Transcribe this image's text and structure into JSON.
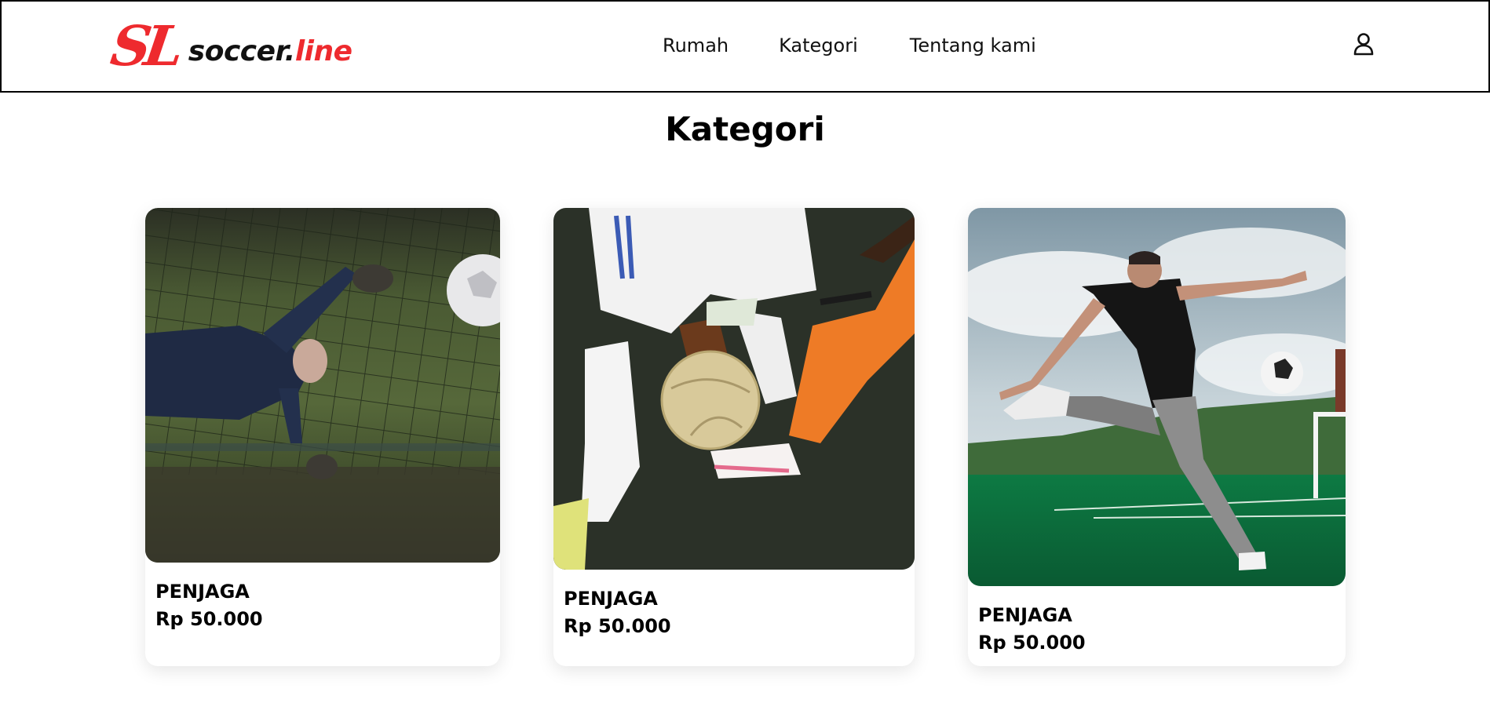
{
  "header": {
    "logo": {
      "mark": "SL",
      "text_dark": "soccer.",
      "text_red": "line"
    },
    "nav": [
      "Rumah",
      "Kategori",
      "Tentang kami"
    ],
    "user_icon": "user-icon"
  },
  "page_title": "Kategori",
  "cards": [
    {
      "name": "PENJAGA",
      "price": "Rp 50.000",
      "photo": "goalkeeper-diving-photo"
    },
    {
      "name": "PENJAGA",
      "price": "Rp 50.000",
      "photo": "players-tackling-ball-photo"
    },
    {
      "name": "PENJAGA",
      "price": "Rp 50.000",
      "photo": "player-kicking-ball-photo"
    }
  ],
  "colors": {
    "brand_red": "#ee2a2e",
    "text": "#000000",
    "background": "#ffffff"
  }
}
